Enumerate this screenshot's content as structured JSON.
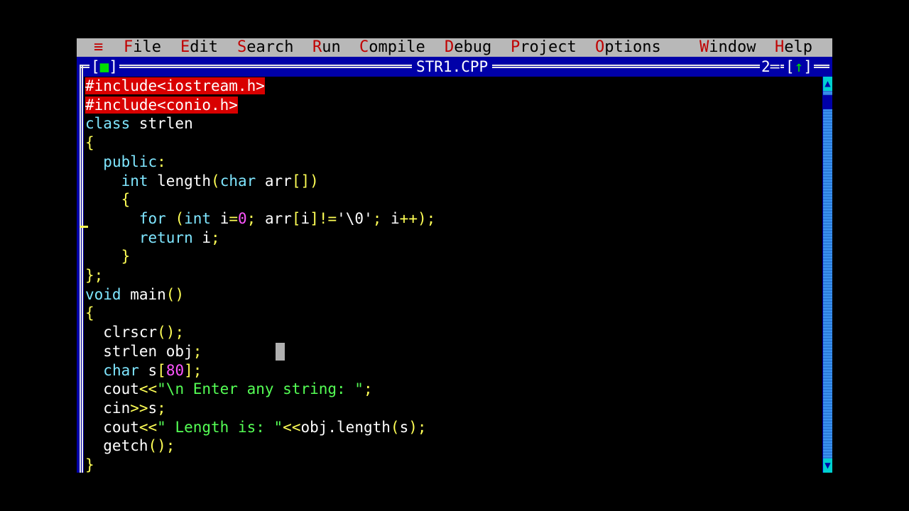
{
  "menu": {
    "system": "≡",
    "items": [
      {
        "hot": "F",
        "rest": "ile"
      },
      {
        "hot": "E",
        "rest": "dit"
      },
      {
        "hot": "S",
        "rest": "earch"
      },
      {
        "hot": "R",
        "rest": "un"
      },
      {
        "hot": "C",
        "rest": "ompile"
      },
      {
        "hot": "D",
        "rest": "ebug"
      },
      {
        "hot": "P",
        "rest": "roject"
      },
      {
        "hot": "O",
        "rest": "ptions"
      },
      {
        "hot": "W",
        "rest": "indow"
      },
      {
        "hot": "H",
        "rest": "elp"
      }
    ]
  },
  "window": {
    "close_left": "[",
    "close_mark": "■",
    "close_right": "]",
    "title": "STR1.CPP",
    "number": "2",
    "zoom_left": "[",
    "zoom_mark": "↑",
    "zoom_right": "]"
  },
  "scrollbar": {
    "up_arrow": "▲",
    "down_arrow": "▼"
  },
  "colors": {
    "menu_bg": "#b8b8b8",
    "menu_hotkey": "#c00000",
    "window_bg": "#0000a8",
    "editor_bg": "#000000",
    "keyword": "#7fe6ff",
    "string": "#55ff55",
    "number": "#ff55ff",
    "punctuation": "#ffff55",
    "preprocessor_bg": "#d80000"
  },
  "code": [
    [
      [
        "pre",
        "#include<iostream.h>"
      ]
    ],
    [
      [
        "pre",
        "#include<conio.h>"
      ]
    ],
    [
      [
        "kw",
        "class"
      ],
      [
        "id",
        " strlen"
      ]
    ],
    [
      [
        "pun",
        "{"
      ]
    ],
    [
      [
        "id",
        "  "
      ],
      [
        "kw",
        "public"
      ],
      [
        "pun",
        ":"
      ]
    ],
    [
      [
        "id",
        "    "
      ],
      [
        "kw",
        "int"
      ],
      [
        "id",
        " length"
      ],
      [
        "pun",
        "("
      ],
      [
        "kw",
        "char"
      ],
      [
        "id",
        " arr"
      ],
      [
        "pun",
        "[])"
      ]
    ],
    [
      [
        "id",
        "    "
      ],
      [
        "pun",
        "{"
      ]
    ],
    [
      [
        "id",
        "      "
      ],
      [
        "kw",
        "for"
      ],
      [
        "id",
        " "
      ],
      [
        "pun",
        "("
      ],
      [
        "kw",
        "int"
      ],
      [
        "id",
        " i"
      ],
      [
        "pun",
        "="
      ],
      [
        "num",
        "0"
      ],
      [
        "pun",
        ";"
      ],
      [
        "id",
        " arr"
      ],
      [
        "pun",
        "["
      ],
      [
        "id",
        "i"
      ],
      [
        "pun",
        "]!="
      ],
      [
        "chr",
        "'\\0'"
      ],
      [
        "pun",
        ";"
      ],
      [
        "id",
        " i"
      ],
      [
        "pun",
        "++);"
      ]
    ],
    [
      [
        "id",
        "      "
      ],
      [
        "kw",
        "return"
      ],
      [
        "id",
        " i"
      ],
      [
        "pun",
        ";"
      ]
    ],
    [
      [
        "id",
        "    "
      ],
      [
        "pun",
        "}"
      ]
    ],
    [
      [
        "pun",
        "};"
      ]
    ],
    [
      [
        "kw",
        "void"
      ],
      [
        "id",
        " main"
      ],
      [
        "pun",
        "()"
      ]
    ],
    [
      [
        "pun",
        "{"
      ]
    ],
    [
      [
        "id",
        "  clrscr"
      ],
      [
        "pun",
        "();"
      ]
    ],
    [
      [
        "id",
        "  strlen obj"
      ],
      [
        "pun",
        ";"
      ]
    ],
    [
      [
        "id",
        "  "
      ],
      [
        "kw",
        "char"
      ],
      [
        "id",
        " s"
      ],
      [
        "pun",
        "["
      ],
      [
        "num",
        "80"
      ],
      [
        "pun",
        "];"
      ]
    ],
    [
      [
        "id",
        "  cout"
      ],
      [
        "pun",
        "<<"
      ],
      [
        "str",
        "\"\\n Enter any string: \""
      ],
      [
        "pun",
        ";"
      ]
    ],
    [
      [
        "id",
        "  cin"
      ],
      [
        "pun",
        ">>"
      ],
      [
        "id",
        "s"
      ],
      [
        "pun",
        ";"
      ]
    ],
    [
      [
        "id",
        "  cout"
      ],
      [
        "pun",
        "<<"
      ],
      [
        "str",
        "\" Length is: \""
      ],
      [
        "pun",
        "<<"
      ],
      [
        "id",
        "obj.length"
      ],
      [
        "pun",
        "("
      ],
      [
        "id",
        "s"
      ],
      [
        "pun",
        ");"
      ]
    ],
    [
      [
        "id",
        "  getch"
      ],
      [
        "pun",
        "();"
      ]
    ],
    [
      [
        "pun",
        "}"
      ]
    ]
  ]
}
